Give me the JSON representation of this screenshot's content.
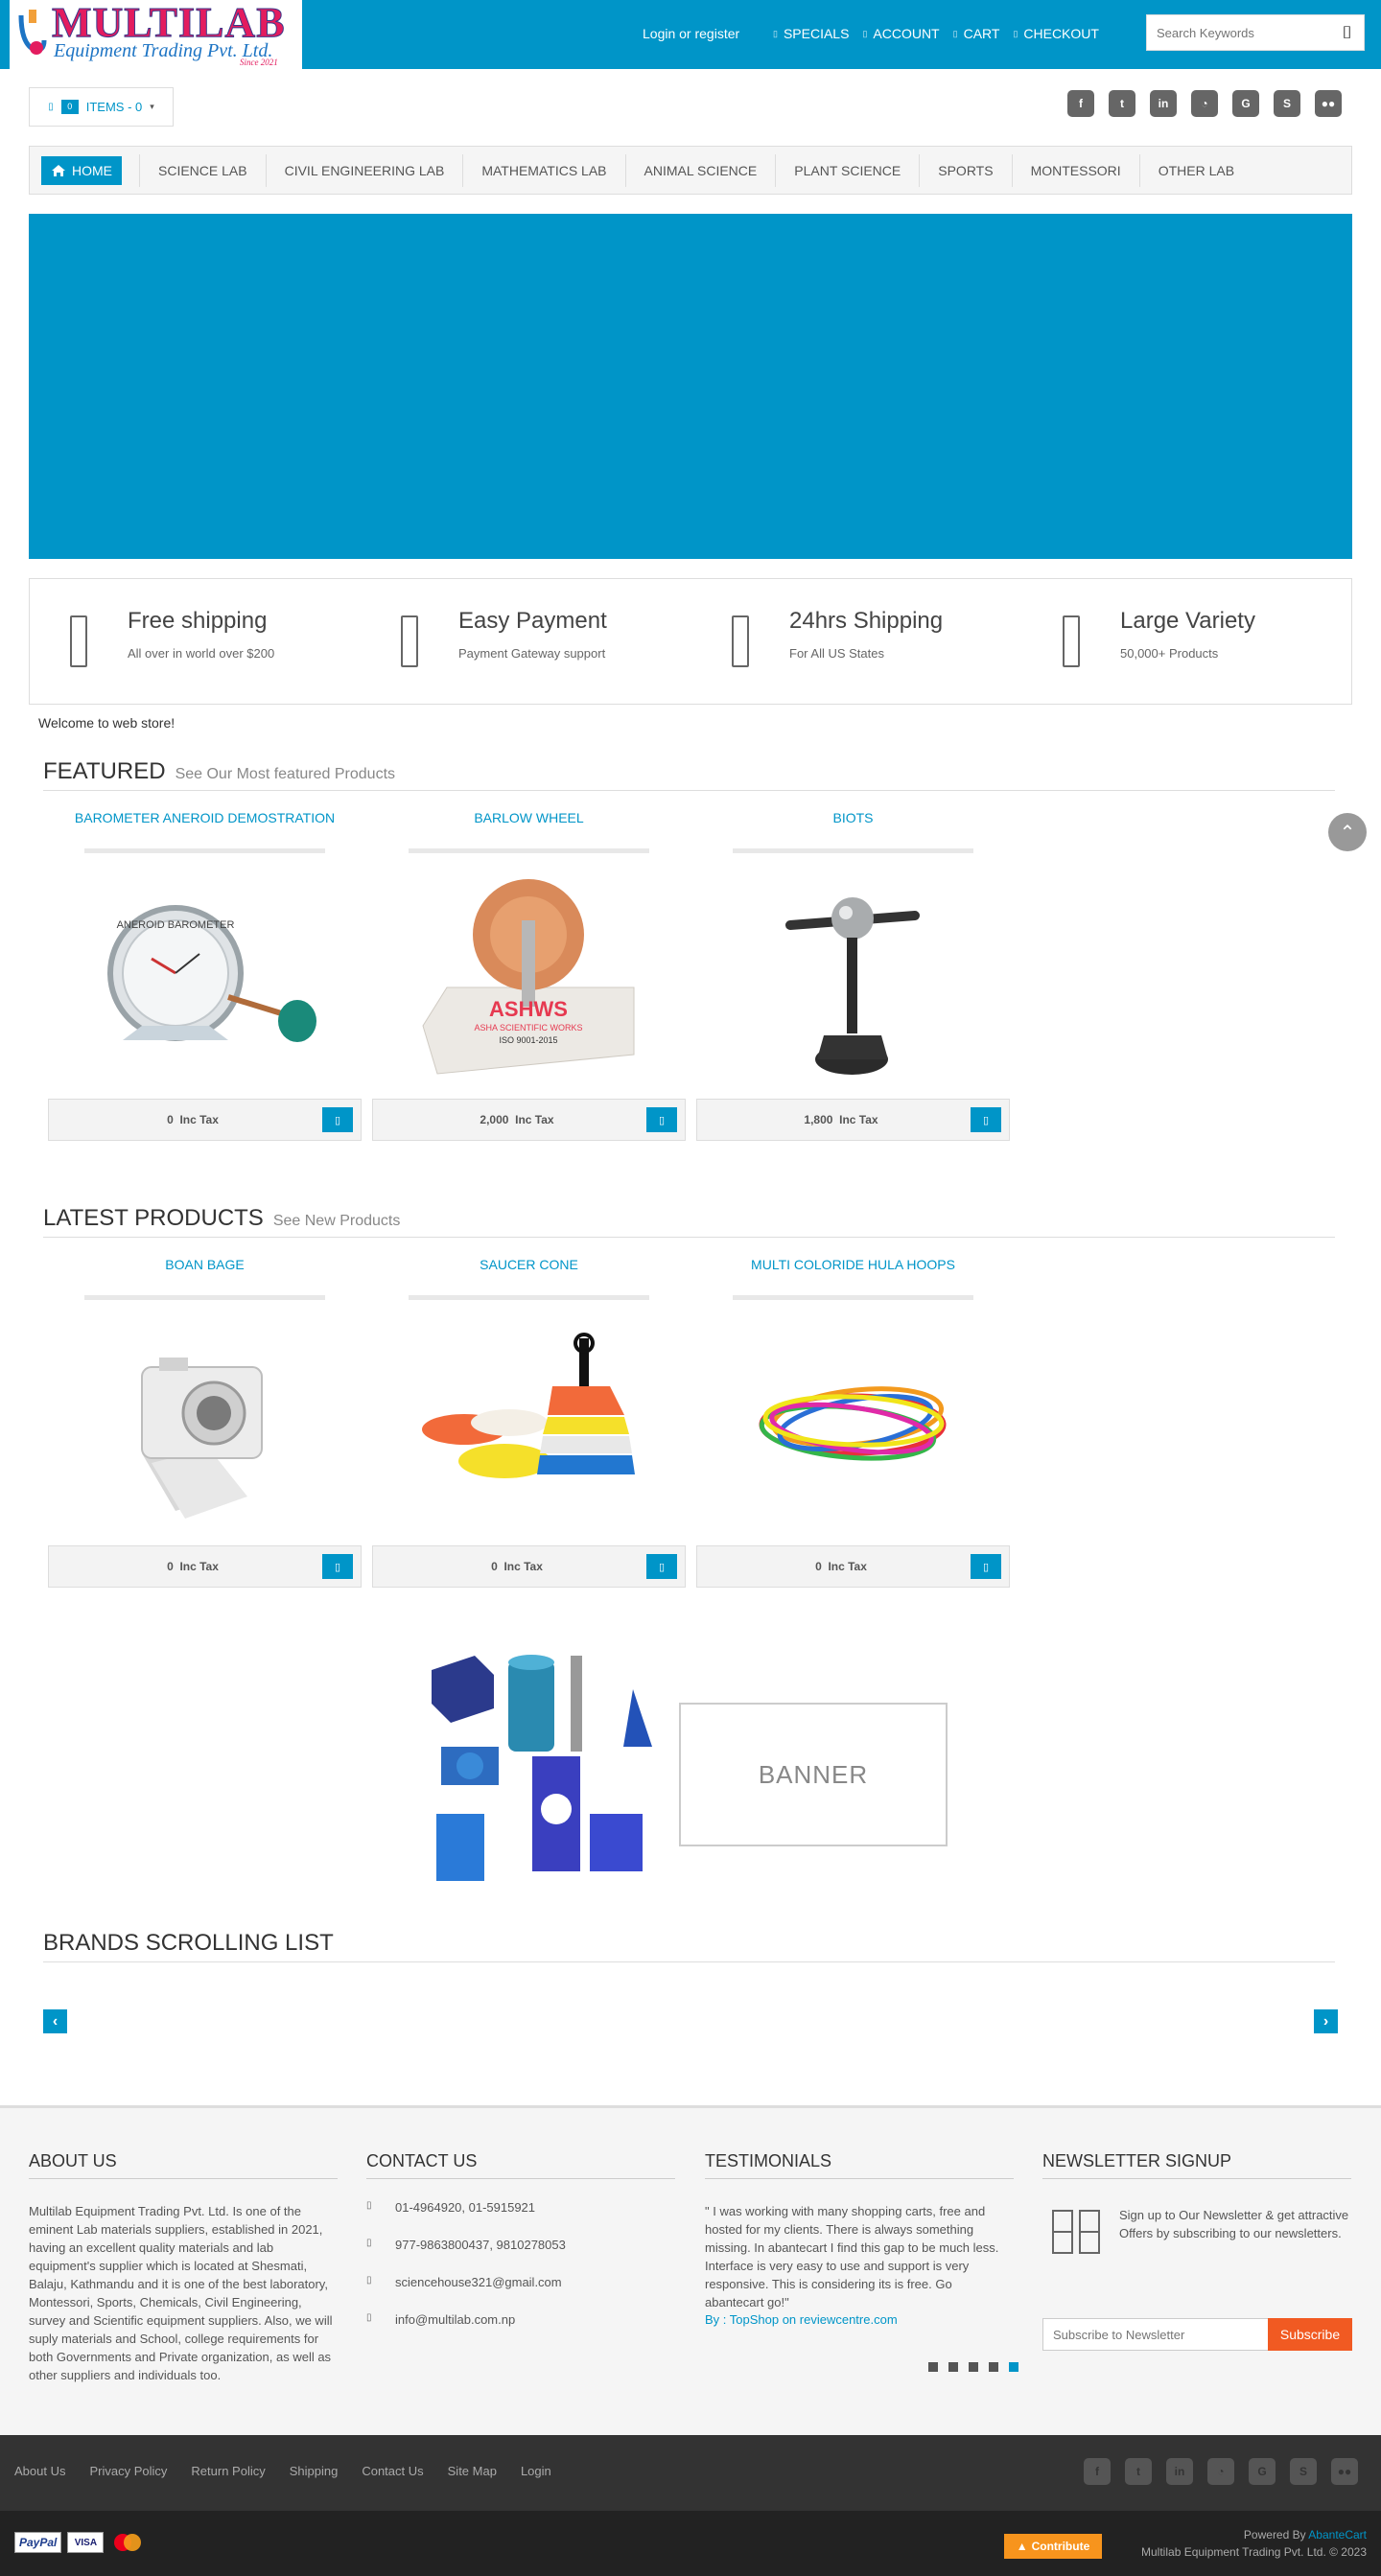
{
  "header": {
    "logo_title": "MULTILAB",
    "logo_subtitle": "Equipment Trading Pvt. Ltd.",
    "logo_since": "Since 2021",
    "login_label": "Login or register",
    "nav": [
      {
        "label": "SPECIALS",
        "icon": "star-icon"
      },
      {
        "label": "ACCOUNT",
        "icon": "user-icon"
      },
      {
        "label": "CART",
        "icon": "cart-icon"
      },
      {
        "label": "CHECKOUT",
        "icon": "checkout-icon"
      }
    ],
    "search_placeholder": "Search Keywords",
    "search_icon": "filter-icon"
  },
  "cart": {
    "badge": "0",
    "label": "ITEMS - 0"
  },
  "socials": [
    "facebook-icon",
    "twitter-icon",
    "linkedin-icon",
    "rss-icon",
    "google-icon",
    "skype-icon",
    "flickr-icon"
  ],
  "categories": {
    "home_label": "HOME",
    "items": [
      "SCIENCE LAB",
      "CIVIL ENGINEERING LAB",
      "MATHEMATICS LAB",
      "ANIMAL SCIENCE",
      "PLANT SCIENCE",
      "SPORTS",
      "MONTESSORI",
      "OTHER LAB"
    ]
  },
  "features": [
    {
      "title": "Free shipping",
      "subtitle": "All over in world over $200"
    },
    {
      "title": "Easy Payment",
      "subtitle": "Payment Gateway support"
    },
    {
      "title": "24hrs Shipping",
      "subtitle": "For All US States"
    },
    {
      "title": "Large Variety",
      "subtitle": "50,000+ Products"
    }
  ],
  "welcome": "Welcome to web store!",
  "featured": {
    "heading": "FEATURED",
    "subheading": "See Our Most featured Products",
    "products": [
      {
        "name": "BAROMETER ANEROID DEMOSTRATION",
        "price": "0",
        "tax": "Inc Tax"
      },
      {
        "name": "BARLOW WHEEL",
        "price": "2,000",
        "tax": "Inc Tax"
      },
      {
        "name": "BIOTS",
        "price": "1,800",
        "tax": "Inc Tax"
      }
    ]
  },
  "latest": {
    "heading": "LATEST PRODUCTS",
    "subheading": "See New Products",
    "products": [
      {
        "name": "BOAN BAGE",
        "price": "0",
        "tax": "Inc Tax"
      },
      {
        "name": "SAUCER CONE",
        "price": "0",
        "tax": "Inc Tax"
      },
      {
        "name": "MULTI COLORIDE HULA HOOPS",
        "price": "0",
        "tax": "Inc Tax"
      }
    ]
  },
  "image_text": {
    "barometer_dial": "ANEROID BAROMETER",
    "barlow_brand": "ASHWS",
    "barlow_brand_sub": "ASHA SCIENTIFIC WORKS",
    "barlow_iso": "ISO 9001-2015"
  },
  "banner_right": "BANNER",
  "brands": {
    "heading": "BRANDS SCROLLING LIST",
    "prev": "‹",
    "next": "›"
  },
  "footer": {
    "about": {
      "heading": "ABOUT US",
      "text": "Multilab Equipment Trading Pvt. Ltd. Is one of the eminent Lab materials suppliers, established in 2021, having an excellent quality materials and lab equipment's supplier which is located at Shesmati, Balaju, Kathmandu and it is one of the best laboratory, Montessori, Sports, Chemicals, Civil Engineering, survey and Scientific equipment suppliers. Also, we will suply materials and School, college requirements for both Governments and Private organization, as well as other suppliers and individuals too."
    },
    "contact": {
      "heading": "CONTACT US",
      "items": [
        "01-4964920, 01-5915921",
        "977-9863800437, 9810278053",
        "sciencehouse321@gmail.com",
        "info@multilab.com.np"
      ]
    },
    "testimonials": {
      "heading": "TESTIMONIALS",
      "text": "\" I was working with many shopping carts, free and hosted for my clients. There is always something missing. In abantecart I find this gap to be much less. Interface is very easy to use and support is very responsive. This is considering its is free. Go abantecart go!\"",
      "author": "By : TopShop on reviewcentre.com",
      "dots": 5,
      "active_dot": 5
    },
    "newsletter": {
      "heading": "NEWSLETTER SIGNUP",
      "text": "Sign up to Our Newsletter & get attractive Offers by subscribing to our newsletters.",
      "placeholder": "Subscribe to Newsletter",
      "button": "Subscribe"
    },
    "links": [
      "About Us",
      "Privacy Policy",
      "Return Policy",
      "Shipping",
      "Contact Us",
      "Site Map",
      "Login"
    ],
    "payment": {
      "paypal": "PayPal",
      "visa": "VISA",
      "mastercard": "MasterCard"
    },
    "contribute": "Contribute",
    "powered_prefix": "Powered By ",
    "powered_link": "AbanteCart",
    "copyright": "Multilab Equipment Trading Pvt. Ltd. © 2023"
  },
  "colors": {
    "accent": "#0095c8",
    "subscribe": "#f15a22",
    "contribute": "#f7941d",
    "footer_dark": "#333333"
  }
}
